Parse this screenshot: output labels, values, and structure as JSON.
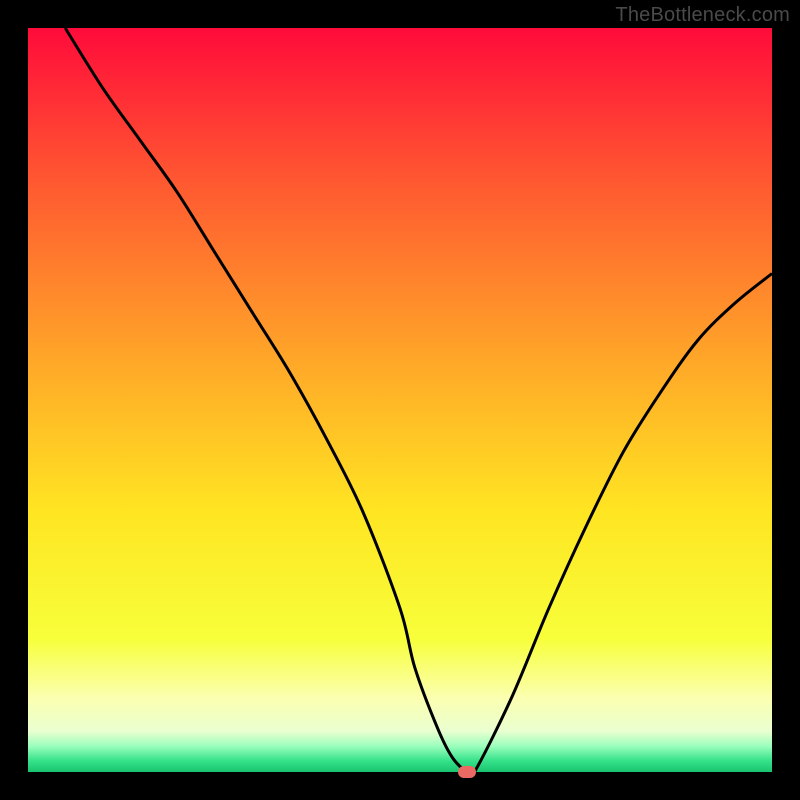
{
  "watermark": "TheBottleneck.com",
  "chart_data": {
    "type": "line",
    "title": "",
    "xlabel": "",
    "ylabel": "",
    "xlim": [
      0,
      100
    ],
    "ylim": [
      0,
      100
    ],
    "curve": {
      "x": [
        5,
        10,
        15,
        20,
        25,
        30,
        35,
        40,
        45,
        50,
        52,
        55,
        57,
        59,
        60,
        65,
        70,
        75,
        80,
        85,
        90,
        95,
        100
      ],
      "y": [
        100,
        92,
        85,
        78,
        70,
        62,
        54,
        45,
        35,
        22,
        14,
        6,
        2,
        0,
        0,
        10,
        22,
        33,
        43,
        51,
        58,
        63,
        67
      ]
    },
    "marker": {
      "x": 59,
      "y": 0,
      "color": "#ea6a63"
    },
    "gradient_stops": [
      {
        "pos": 0.0,
        "color": "#ff0b3a"
      },
      {
        "pos": 0.2,
        "color": "#ff5631"
      },
      {
        "pos": 0.45,
        "color": "#ffa828"
      },
      {
        "pos": 0.65,
        "color": "#ffe522"
      },
      {
        "pos": 0.82,
        "color": "#f7ff3a"
      },
      {
        "pos": 0.9,
        "color": "#fbffb0"
      },
      {
        "pos": 0.945,
        "color": "#eaffd0"
      },
      {
        "pos": 0.965,
        "color": "#9cffbd"
      },
      {
        "pos": 0.985,
        "color": "#35e28a"
      },
      {
        "pos": 1.0,
        "color": "#18c46e"
      }
    ],
    "curve_stroke": "#000000",
    "curve_stroke_width": 3
  }
}
